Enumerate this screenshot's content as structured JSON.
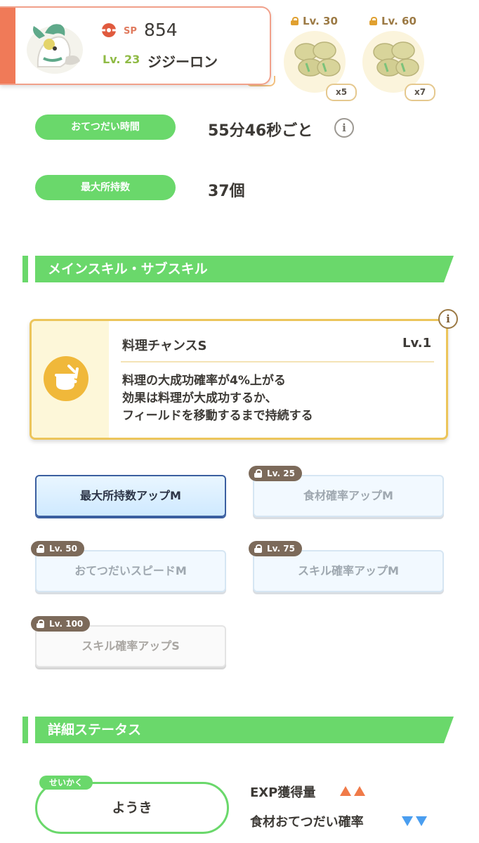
{
  "pokemon": {
    "sp_label": "SP",
    "sp_value": "854",
    "level": "Lv. 23",
    "name": "ジジーロン"
  },
  "ingredient_slots": [
    {
      "unlock": "Lv. 30",
      "count": "x5",
      "icon": "bean-icon"
    },
    {
      "unlock": "Lv. 60",
      "count": "x7",
      "icon": "bean-icon"
    }
  ],
  "stats": [
    {
      "label": "おてつだい時間",
      "value": "55分46秒ごと",
      "has_info": true
    },
    {
      "label": "最大所持数",
      "value": "37個",
      "has_info": false
    }
  ],
  "sections": {
    "skills_title": "メインスキル・サブスキル",
    "details_title": "詳細ステータス"
  },
  "main_skill": {
    "name": "料理チャンスS",
    "level": "Lv.1",
    "description": [
      "料理の大成功確率が4%上がる",
      "効果は料理が大成功するか、",
      "フィールドを移動するまで持続する"
    ],
    "icon": "cooking-pot-icon",
    "info_glyph": "i"
  },
  "sub_skills": [
    {
      "label": "最大所持数アップM",
      "unlock": "",
      "state": "active"
    },
    {
      "label": "食材確率アップM",
      "unlock": "Lv. 25",
      "state": "locked"
    },
    {
      "label": "おてつだいスピードM",
      "unlock": "Lv. 50",
      "state": "locked"
    },
    {
      "label": "スキル確率アップM",
      "unlock": "Lv. 75",
      "state": "locked"
    },
    {
      "label": "スキル確率アップS",
      "unlock": "Lv. 100",
      "state": "locked"
    }
  ],
  "nature": {
    "tag": "せいかく",
    "value": "ようき",
    "effects": [
      {
        "label": "EXP獲得量",
        "direction": "up",
        "strength": 2
      },
      {
        "label": "食材おてつだい確率",
        "direction": "down",
        "strength": 2
      }
    ]
  },
  "colors": {
    "accent_green": "#6ad86b",
    "card_orange": "#f07a58",
    "skill_gold": "#ecc55b",
    "up_arrow": "#f07a48",
    "down_arrow": "#4a9ef0"
  },
  "info_glyph": "i"
}
